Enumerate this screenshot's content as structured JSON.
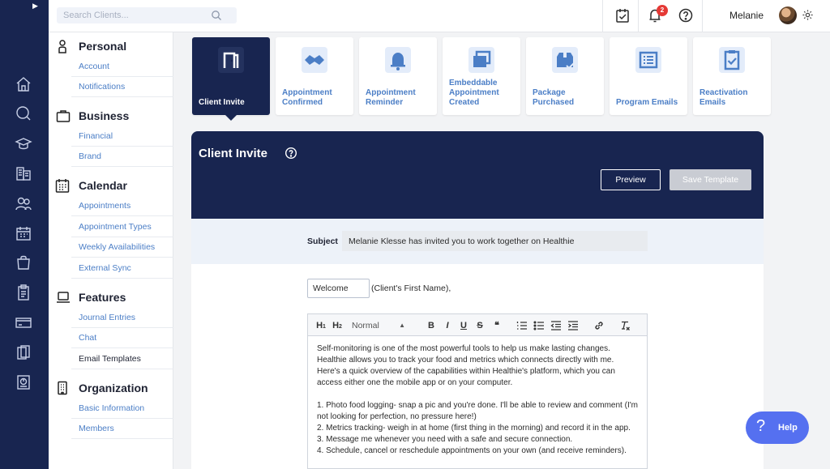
{
  "topbar": {
    "search_placeholder": "Search Clients...",
    "notification_count": "2",
    "user_name": "Melanie"
  },
  "sidebar": {
    "sections": [
      {
        "title": "Personal",
        "icon": "person-icon",
        "items": [
          "Account",
          "Notifications"
        ]
      },
      {
        "title": "Business",
        "icon": "briefcase-icon",
        "items": [
          "Financial",
          "Brand"
        ]
      },
      {
        "title": "Calendar",
        "icon": "calendar-icon",
        "items": [
          "Appointments",
          "Appointment Types",
          "Weekly Availabilities",
          "External Sync"
        ]
      },
      {
        "title": "Features",
        "icon": "laptop-icon",
        "items": [
          "Journal Entries",
          "Chat",
          "Email Templates"
        ]
      },
      {
        "title": "Organization",
        "icon": "building-icon",
        "items": [
          "Basic Information",
          "Members"
        ]
      }
    ],
    "active_item": "Email Templates"
  },
  "templates": [
    {
      "label": "Client Invite",
      "icon": "door-icon",
      "active": true
    },
    {
      "label": "Appointment Confirmed",
      "icon": "handshake-icon",
      "active": false
    },
    {
      "label": "Appointment Reminder",
      "icon": "bell-icon",
      "active": false
    },
    {
      "label": "Embeddable Appointment Created",
      "icon": "windows-icon",
      "active": false
    },
    {
      "label": "Package Purchased",
      "icon": "package-icon",
      "active": false
    },
    {
      "label": "Program Emails",
      "icon": "list-icon",
      "active": false
    },
    {
      "label": "Reactivation Emails",
      "icon": "checklist-icon",
      "active": false
    }
  ],
  "editor": {
    "title": "Client Invite",
    "preview_label": "Preview",
    "save_label": "Save Template",
    "subject_label": "Subject",
    "subject_value": "Melanie Klesse has invited you to work together on Healthie",
    "greeting_value": "Welcome",
    "greeting_suffix": "(Client's First Name),",
    "format_select": "Normal",
    "body": [
      "Self-monitoring is one of the most powerful tools to help us make lasting changes. Healthie allows you to track your food and metrics which connects directly with me. Here's a quick overview of the capabilities within Healthie's platform, which you can access either one the mobile app or on your computer.",
      "1. Photo food logging- snap a pic and you're done. I'll be able to review and comment (I'm not looking for perfection, no pressure here!)",
      "2. Metrics tracking- weigh in at home (first thing in the morning) and record it in the app.",
      "3. Message me whenever you need with a safe and secure connection.",
      "4. Schedule, cancel or reschedule appointments on your own (and receive reminders)."
    ]
  },
  "help": {
    "label": "Help"
  },
  "colors": {
    "navy": "#182550",
    "link": "#4b7ec6",
    "help": "#5570f0",
    "badge": "#e53935"
  }
}
